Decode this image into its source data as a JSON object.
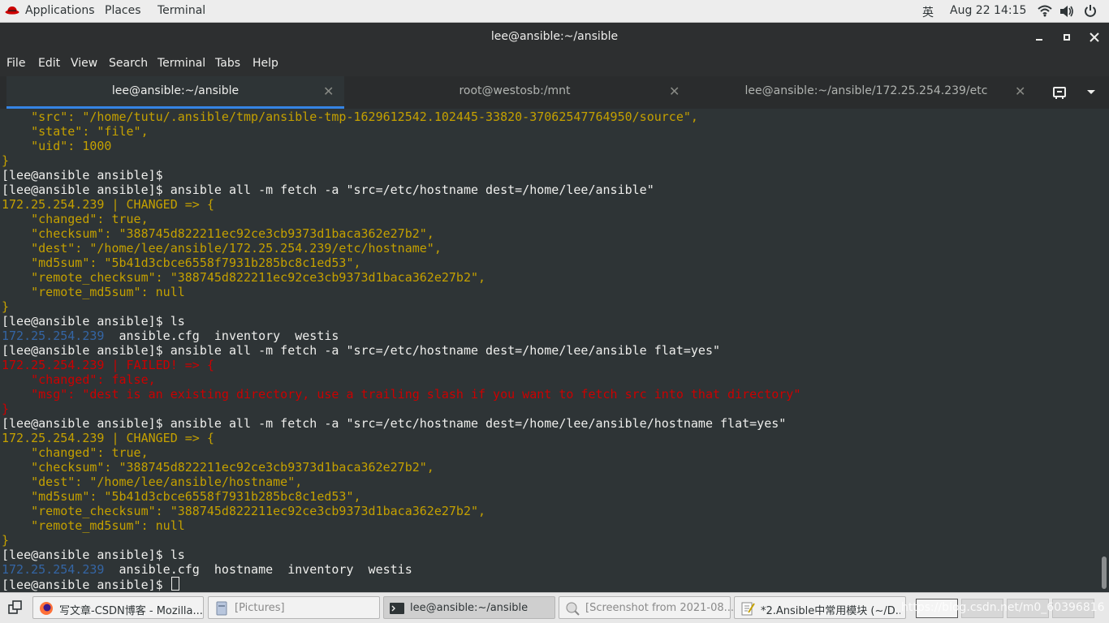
{
  "topbar": {
    "applications": "Applications",
    "places": "Places",
    "terminal": "Terminal",
    "ime": "英",
    "clock": "Aug 22  14:15"
  },
  "window": {
    "title": "lee@ansible:~/ansible"
  },
  "menu": [
    "File",
    "Edit",
    "View",
    "Search",
    "Terminal",
    "Tabs",
    "Help"
  ],
  "tabs": [
    {
      "label": "lee@ansible:~/ansible"
    },
    {
      "label": "root@westosb:/mnt"
    },
    {
      "label": "lee@ansible:~/ansible/172.25.254.239/etc"
    }
  ],
  "terminal_lines": [
    {
      "t": "    \"src\": \"/home/tutu/.ansible/tmp/ansible-tmp-1629612542.102445-33820-37062547764950/source\",",
      "c": "yellow"
    },
    {
      "t": "    \"state\": \"file\",",
      "c": "yellow"
    },
    {
      "t": "    \"uid\": 1000",
      "c": "yellow"
    },
    {
      "t": "}",
      "c": "yellow"
    },
    {
      "t": "[lee@ansible ansible]$",
      "c": ""
    },
    {
      "t": "[lee@ansible ansible]$ ansible all -m fetch -a \"src=/etc/hostname dest=/home/lee/ansible\"",
      "c": ""
    },
    {
      "t": "172.25.254.239 | CHANGED => {",
      "c": "yellow"
    },
    {
      "t": "    \"changed\": true,",
      "c": "yellow"
    },
    {
      "t": "    \"checksum\": \"388745d822211ec92ce3cb9373d1baca362e27b2\",",
      "c": "yellow"
    },
    {
      "t": "    \"dest\": \"/home/lee/ansible/172.25.254.239/etc/hostname\",",
      "c": "yellow"
    },
    {
      "t": "    \"md5sum\": \"5b41d3cbce6558f7931b285bc8c1ed53\",",
      "c": "yellow"
    },
    {
      "t": "    \"remote_checksum\": \"388745d822211ec92ce3cb9373d1baca362e27b2\",",
      "c": "yellow"
    },
    {
      "t": "    \"remote_md5sum\": null",
      "c": "yellow"
    },
    {
      "t": "}",
      "c": "yellow"
    },
    {
      "t": "[lee@ansible ansible]$ ls",
      "c": ""
    },
    {
      "t": "LS1",
      "c": "ls1"
    },
    {
      "t": "[lee@ansible ansible]$ ansible all -m fetch -a \"src=/etc/hostname dest=/home/lee/ansible flat=yes\"",
      "c": ""
    },
    {
      "t": "172.25.254.239 | FAILED! => {",
      "c": "red"
    },
    {
      "t": "    \"changed\": false,",
      "c": "red"
    },
    {
      "t": "    \"msg\": \"dest is an existing directory, use a trailing slash if you want to fetch src into that directory\"",
      "c": "red"
    },
    {
      "t": "}",
      "c": "red"
    },
    {
      "t": "[lee@ansible ansible]$ ansible all -m fetch -a \"src=/etc/hostname dest=/home/lee/ansible/hostname flat=yes\"",
      "c": ""
    },
    {
      "t": "172.25.254.239 | CHANGED => {",
      "c": "yellow"
    },
    {
      "t": "    \"changed\": true,",
      "c": "yellow"
    },
    {
      "t": "    \"checksum\": \"388745d822211ec92ce3cb9373d1baca362e27b2\",",
      "c": "yellow"
    },
    {
      "t": "    \"dest\": \"/home/lee/ansible/hostname\",",
      "c": "yellow"
    },
    {
      "t": "    \"md5sum\": \"5b41d3cbce6558f7931b285bc8c1ed53\",",
      "c": "yellow"
    },
    {
      "t": "    \"remote_checksum\": \"388745d822211ec92ce3cb9373d1baca362e27b2\",",
      "c": "yellow"
    },
    {
      "t": "    \"remote_md5sum\": null",
      "c": "yellow"
    },
    {
      "t": "}",
      "c": "yellow"
    },
    {
      "t": "[lee@ansible ansible]$ ls",
      "c": ""
    },
    {
      "t": "LS2",
      "c": "ls2"
    },
    {
      "t": "[lee@ansible ansible]$ ",
      "c": "prompt"
    }
  ],
  "ls1": {
    "dir": "172.25.254.239",
    "rest": "  ansible.cfg  inventory  westis"
  },
  "ls2": {
    "dir": "172.25.254.239",
    "rest": "  ansible.cfg  hostname  inventory  westis"
  },
  "taskbar": [
    {
      "label": "写文章-CSDN博客 - Mozilla...",
      "icon": "firefox-icon"
    },
    {
      "label": "[Pictures]",
      "icon": "folder-icon"
    },
    {
      "label": "lee@ansible:~/ansible",
      "icon": "terminal-icon"
    },
    {
      "label": "[Screenshot from 2021-08...",
      "icon": "image-viewer-icon"
    },
    {
      "label": "*2.Ansible中常用模块 (~/D...",
      "icon": "text-editor-icon"
    }
  ],
  "watermark": "https://blog.csdn.net/m0_60396816",
  "colors": {
    "yellow": "#c4a000",
    "red": "#cc0000",
    "blue": "#3465a4",
    "tab_accent": "#3584e4"
  }
}
